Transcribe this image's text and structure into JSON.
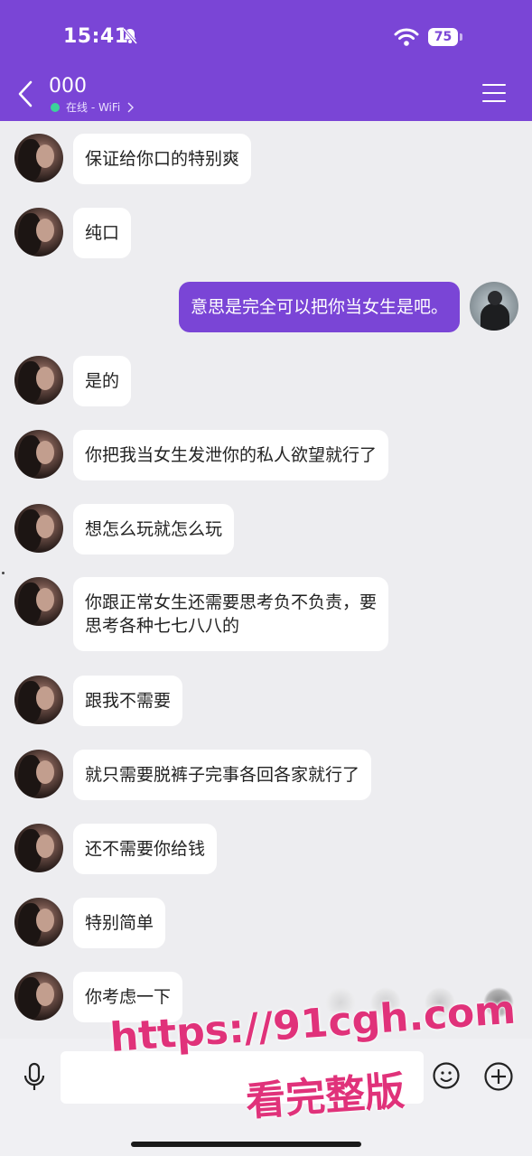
{
  "status_bar": {
    "time": "15:41",
    "battery": "75"
  },
  "header": {
    "title": "000",
    "subtitle": "在线 - WiFi"
  },
  "messages": [
    {
      "from": "her",
      "lines": [
        "保证给你口的特别爽"
      ]
    },
    {
      "from": "her",
      "lines": [
        "纯口"
      ]
    },
    {
      "from": "me",
      "lines": [
        "意思是完全可以把你当女生是吧。"
      ]
    },
    {
      "from": "her",
      "lines": [
        "是的"
      ]
    },
    {
      "from": "her",
      "lines": [
        "你把我当女生发泄你的私人欲望就行了"
      ]
    },
    {
      "from": "her",
      "lines": [
        "想怎么玩就怎么玩"
      ]
    },
    {
      "from": "her",
      "lines": [
        "你跟正常女生还需要思考负不负责，要",
        "思考各种七七八八的"
      ]
    },
    {
      "from": "her",
      "lines": [
        "跟我不需要"
      ]
    },
    {
      "from": "her",
      "lines": [
        "就只需要脱裤子完事各回各家就行了"
      ]
    },
    {
      "from": "her",
      "lines": [
        "还不需要你给钱"
      ]
    },
    {
      "from": "her",
      "lines": [
        "特别简单"
      ]
    },
    {
      "from": "her",
      "lines": [
        "你考虑一下"
      ]
    }
  ],
  "watermark": {
    "url": "https://91cgh.com",
    "cta": "看完整版"
  },
  "icons": {
    "back": "chevron-left-icon",
    "menu": "menu-icon",
    "mute": "bell-off-icon",
    "wifi": "wifi-icon",
    "mic": "microphone-icon",
    "sticker": "sticker-icon",
    "plus": "plus-icon"
  },
  "colors": {
    "accent": "#7a45d6",
    "online": "#3bd39a",
    "watermark": "#e0327a"
  }
}
